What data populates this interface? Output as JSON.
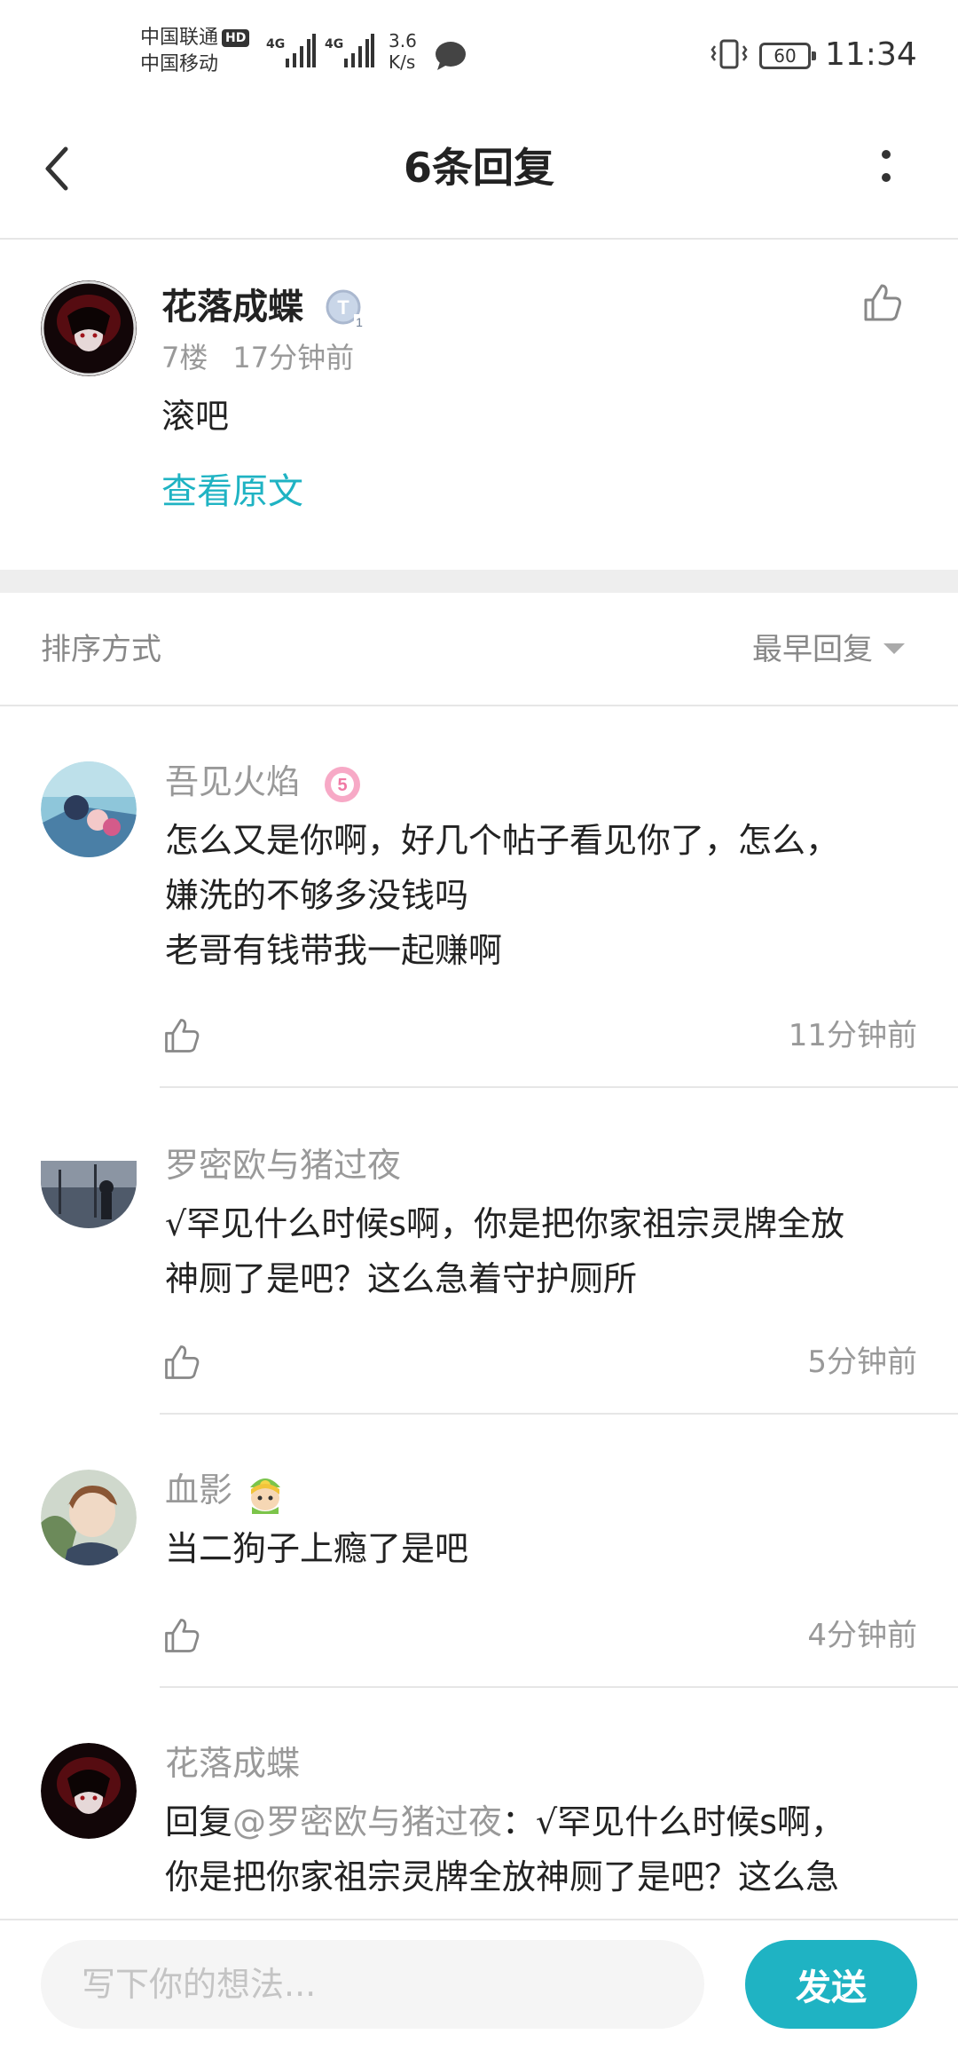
{
  "status_bar": {
    "carrier_1": "中国联通",
    "carrier_1_badge": "HD",
    "carrier_2": "中国移动",
    "network_1": "4G",
    "network_2": "4G",
    "speed_value": "3.6",
    "speed_unit": "K/s",
    "battery": "60",
    "time": "11:34",
    "icons": [
      "signal-icon",
      "message-icon",
      "vibrate-icon",
      "battery-icon"
    ]
  },
  "header": {
    "title": "6条回复",
    "back_icon": "chevron-left-icon",
    "more_icon": "more-vertical-icon"
  },
  "original_post": {
    "author": "花落成蝶",
    "badge_icon": "level-t1-badge-icon",
    "floor": "7楼",
    "time": "17分钟前",
    "content": "滚吧",
    "view_original": "查看原文"
  },
  "sort": {
    "label": "排序方式",
    "selected": "最早回复"
  },
  "replies": [
    {
      "author": "吾见火焰",
      "badge_icon": "level-5-badge-icon",
      "lines": [
        "怎么又是你啊，好几个帖子看见你了，怎么，",
        "嫌洗的不够多没钱吗",
        "老哥有钱带我一起赚啊"
      ],
      "time": "11分钟前"
    },
    {
      "author": "罗密欧与猪过夜",
      "lines": [
        "√罕见什么时候s啊，你是把你家祖宗灵牌全放",
        "神厕了是吧？这么急着守护厕所"
      ],
      "time": "5分钟前"
    },
    {
      "author": "血影",
      "badge_icon": "character-badge-icon",
      "lines": [
        "当二狗子上瘾了是吧"
      ],
      "time": "4分钟前"
    },
    {
      "author": "花落成蝶",
      "reply_prefix": "回复",
      "mention": "@罗密欧与猪过夜",
      "line_1_rest": "：√罕见什么时候s啊，",
      "line_2": "你是把你家祖宗灵牌全放神厕了是吧？这么急"
    }
  ],
  "input_bar": {
    "placeholder": "写下你的想法...",
    "send_label": "发送"
  },
  "colors": {
    "accent": "#1fb3c3",
    "muted_text": "#999999",
    "divider": "#e6e6e6"
  }
}
